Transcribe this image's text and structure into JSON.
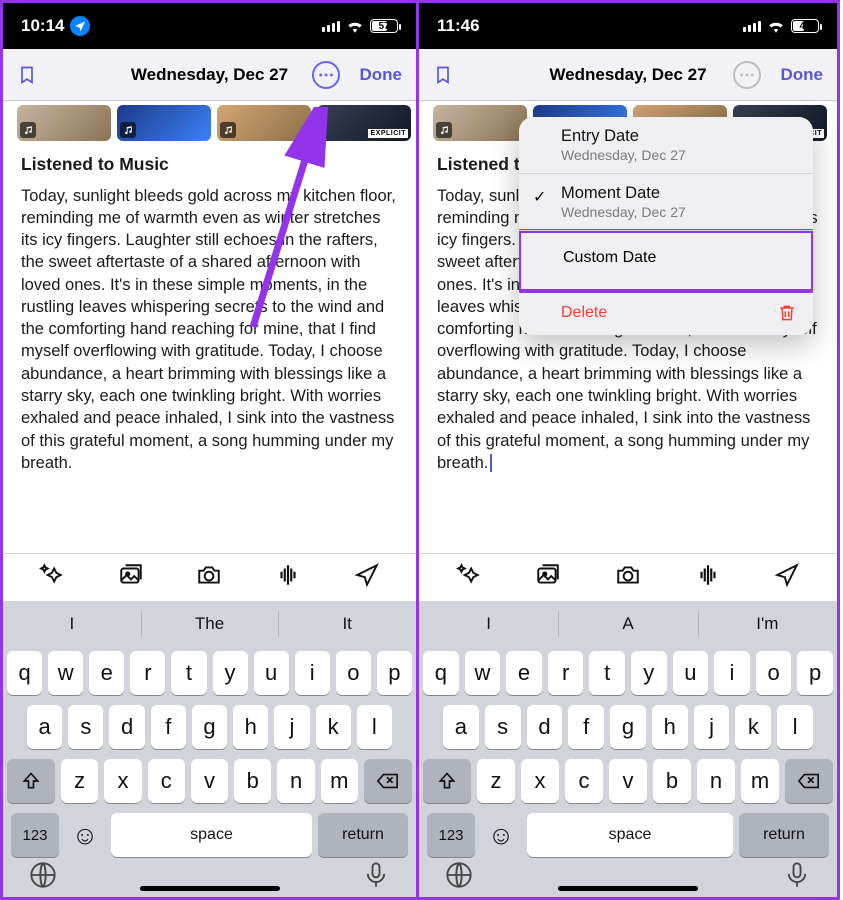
{
  "left": {
    "status": {
      "time": "10:14",
      "battery": "57"
    },
    "header": {
      "date": "Wednesday, Dec 27",
      "done": "Done"
    },
    "entry": {
      "title": "Listened to Music",
      "body": "Today, sunlight bleeds gold across my kitchen floor, reminding me of warmth even as winter stretches its icy fingers. Laughter still echoes in the rafters, the sweet aftertaste of a shared afternoon with loved ones. It's in these simple moments, in the rustling leaves whispering secrets to the wind and the comforting hand reaching for mine, that I find myself overflowing with gratitude. Today, I choose abundance, a heart brimming with blessings like a starry sky, each one twinkling bright. With worries exhaled and peace inhaled, I sink into the vastness of this grateful moment, a song humming under my breath."
    },
    "predictions": [
      "I",
      "The",
      "It"
    ]
  },
  "right": {
    "status": {
      "time": "11:46",
      "battery": "44"
    },
    "header": {
      "date": "Wednesday, Dec 27",
      "done": "Done"
    },
    "entry": {
      "title": "Listened to Music",
      "body": "Today, sunlight bleeds gold across my kitchen floor, reminding me of warmth even as winter stretches its icy fingers. Laughter still echoes in the rafters, the sweet aftertaste of a shared afternoon with loved ones. It's in these simple moments, in the rustling leaves whispering secrets to the wind and the comforting hand reaching for mine, that I find myself overflowing with gratitude. Today, I choose abundance, a heart brimming with blessings like a starry sky, each one twinkling bright. With worries exhaled and peace inhaled, I sink into the vastness of this grateful moment, a song humming under my breath."
    },
    "popover": {
      "entry_date_label": "Entry Date",
      "entry_date_value": "Wednesday, Dec 27",
      "moment_date_label": "Moment Date",
      "moment_date_value": "Wednesday, Dec 27",
      "custom_date_label": "Custom Date",
      "delete_label": "Delete"
    },
    "predictions": [
      "I",
      "A",
      "I'm"
    ]
  },
  "keyboard": {
    "rows": [
      [
        "q",
        "w",
        "e",
        "r",
        "t",
        "y",
        "u",
        "i",
        "o",
        "p"
      ],
      [
        "a",
        "s",
        "d",
        "f",
        "g",
        "h",
        "j",
        "k",
        "l"
      ],
      [
        "z",
        "x",
        "c",
        "v",
        "b",
        "n",
        "m"
      ]
    ],
    "key_123": "123",
    "space": "space",
    "return": "return"
  },
  "media": {
    "explicit_badge": "EXPLICIT"
  }
}
